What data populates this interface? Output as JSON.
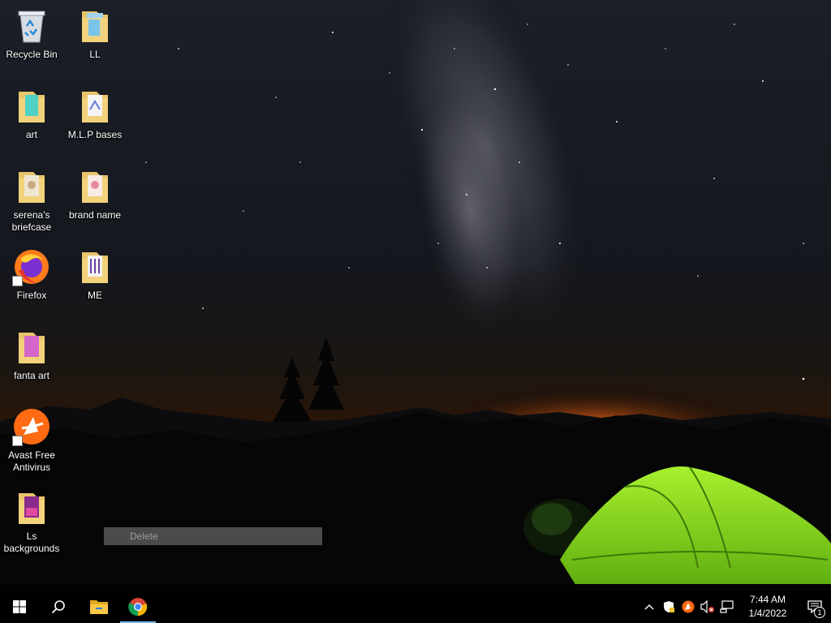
{
  "desktop": {
    "icons": [
      {
        "label": "Recycle Bin",
        "icon": "recycle-bin-icon"
      },
      {
        "label": "LL",
        "icon": "folder-icon"
      },
      {
        "label": "art",
        "icon": "folder-icon"
      },
      {
        "label": "M.L.P bases",
        "icon": "folder-icon"
      },
      {
        "label": "serena's briefcase",
        "icon": "folder-icon"
      },
      {
        "label": "brand name",
        "icon": "folder-icon"
      },
      {
        "label": "Firefox",
        "icon": "firefox-icon"
      },
      {
        "label": "ME",
        "icon": "folder-icon"
      },
      {
        "label": "fanta art",
        "icon": "folder-icon"
      },
      {
        "label": "Avast Free Antivirus",
        "icon": "avast-icon"
      },
      {
        "label": "Ls backgrounds",
        "icon": "folder-icon"
      }
    ]
  },
  "context_menu": {
    "delete_label": "Delete"
  },
  "taskbar": {
    "pinned": [
      {
        "name": "start",
        "icon": "windows-logo-icon"
      },
      {
        "name": "search",
        "icon": "search-icon"
      },
      {
        "name": "file-explorer",
        "icon": "file-explorer-icon"
      },
      {
        "name": "chrome",
        "icon": "chrome-icon",
        "active": true
      }
    ],
    "tray": {
      "icons": [
        "chevron-up-icon",
        "security-shield-icon",
        "avast-tray-icon",
        "volume-muted-icon",
        "network-icon"
      ],
      "time": "7:44 AM",
      "date": "1/4/2022",
      "notification_count": "1"
    }
  },
  "colors": {
    "taskbar_bg": "#000000",
    "accent": "#76b9ed",
    "tent_green": "#8fe02a",
    "horizon_orange": "#e8661c"
  }
}
